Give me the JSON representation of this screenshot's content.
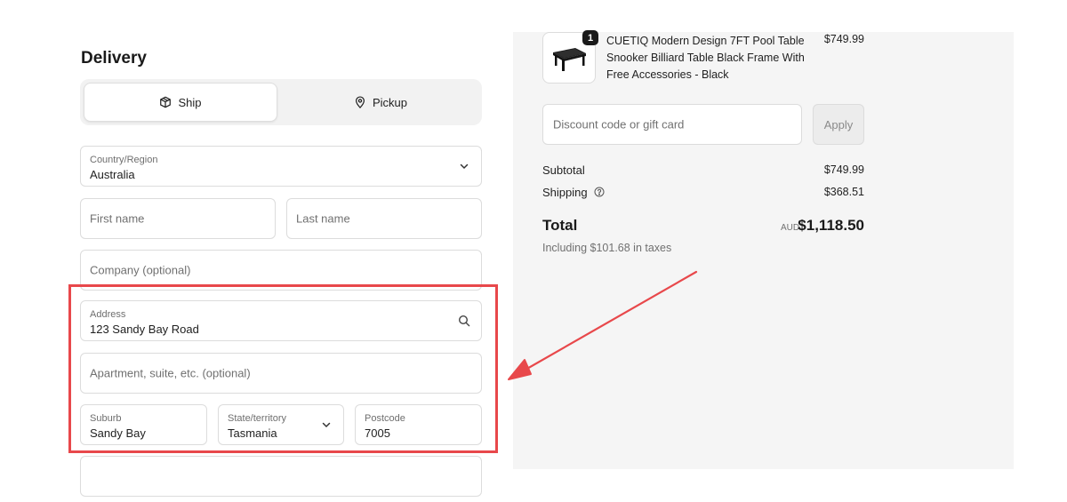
{
  "delivery": {
    "title": "Delivery",
    "methods": [
      {
        "label": "Ship",
        "icon": "package-icon",
        "selected": true
      },
      {
        "label": "Pickup",
        "icon": "map-pin-icon",
        "selected": false
      }
    ]
  },
  "form": {
    "country": {
      "label": "Country/Region",
      "value": "Australia"
    },
    "first_name": {
      "placeholder": "First name"
    },
    "last_name": {
      "placeholder": "Last name"
    },
    "company": {
      "placeholder": "Company (optional)"
    },
    "address": {
      "label": "Address",
      "value": "123 Sandy Bay Road"
    },
    "apartment": {
      "placeholder": "Apartment, suite, etc. (optional)"
    },
    "suburb": {
      "label": "Suburb",
      "value": "Sandy Bay"
    },
    "state": {
      "label": "State/territory",
      "value": "Tasmania"
    },
    "postcode": {
      "label": "Postcode",
      "value": "7005"
    }
  },
  "summary": {
    "product": {
      "name": "CUETIQ Modern Design 7FT Pool Table Snooker Billiard Table Black Frame With Free Accessories - Black",
      "price": "$749.99",
      "quantity": "1"
    },
    "discount": {
      "placeholder": "Discount code or gift card",
      "apply_label": "Apply"
    },
    "subtotal_label": "Subtotal",
    "subtotal_value": "$749.99",
    "shipping_label": "Shipping",
    "shipping_value": "$368.51",
    "total_label": "Total",
    "total_currency": "AUD",
    "total_value": "$1,118.50",
    "tax_note": "Including $101.68 in taxes"
  },
  "colors": {
    "highlight": "#e8484b",
    "summary_background": "#f5f5f5"
  }
}
